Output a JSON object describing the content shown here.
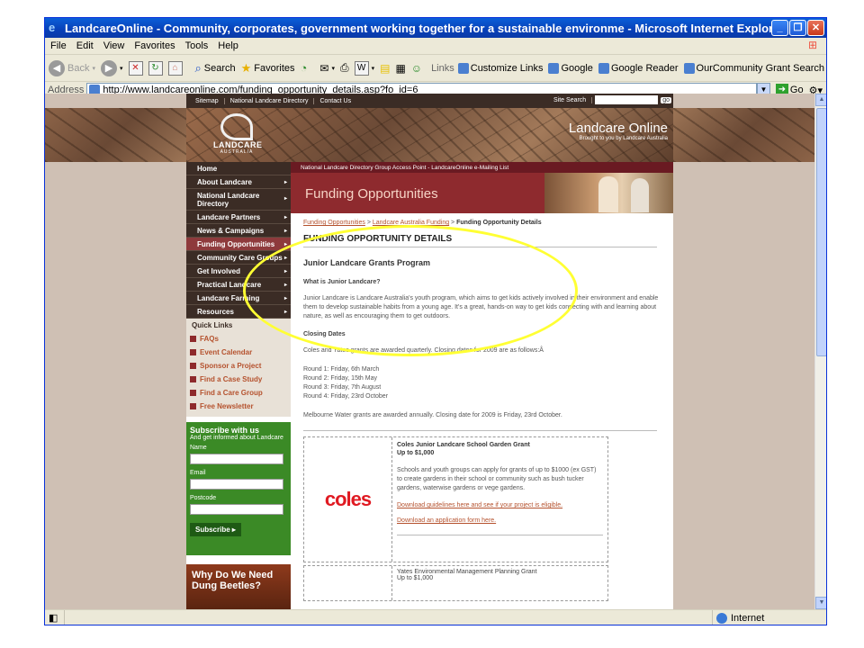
{
  "window": {
    "title": "LandcareOnline - Community, corporates, government working together for a sustainable environme - Microsoft Internet Explorer",
    "controls": [
      "_",
      "❐",
      "✕"
    ]
  },
  "menu": [
    "File",
    "Edit",
    "View",
    "Favorites",
    "Tools",
    "Help"
  ],
  "toolbar": {
    "back": "Back",
    "search": "Search",
    "favorites": "Favorites",
    "links_label": "Links",
    "links": [
      "Customize Links",
      "Google",
      "Google Reader",
      "OurCommunity Grant Search"
    ]
  },
  "address": {
    "label": "Address",
    "url": "http://www.landcareonline.com/funding_opportunity_details.asp?fo_id=6",
    "go": "Go"
  },
  "status": {
    "zone": "Internet"
  },
  "site": {
    "topnav": [
      "Sitemap",
      "National Landcare Directory",
      "Contact Us"
    ],
    "search_label": "Site Search",
    "search_go": "go",
    "logo_word": "LANDCARE",
    "logo_sub": "AUSTRALIA",
    "brand": "Landcare Online",
    "brand_tag": "Brought to you by Landcare Australia",
    "ribbon": "National Landcare Directory Group Access Point - LandcareOnline e-Mailing List",
    "hero_title": "Funding Opportunities",
    "nav": [
      {
        "label": "Home",
        "arrow": ""
      },
      {
        "label": "About Landcare",
        "arrow": "▸"
      },
      {
        "label": "National Landcare Directory",
        "arrow": "▸"
      },
      {
        "label": "Landcare Partners",
        "arrow": "▸"
      },
      {
        "label": "News & Campaigns",
        "arrow": "▸"
      },
      {
        "label": "Funding Opportunities",
        "arrow": "▸"
      },
      {
        "label": "Community Care Groups",
        "arrow": "▸"
      },
      {
        "label": "Get Involved",
        "arrow": "▸"
      },
      {
        "label": "Practical Landcare",
        "arrow": "▸"
      },
      {
        "label": "Landcare Farming",
        "arrow": "▸"
      },
      {
        "label": "Resources",
        "arrow": "▸"
      }
    ],
    "quick_title": "Quick Links",
    "quick": [
      "FAQs",
      "Event Calendar",
      "Sponsor a Project",
      "Find a Case Study",
      "Find a Care Group",
      "Free Newsletter"
    ],
    "subscribe": {
      "heading": "Subscribe with us",
      "desc": "And get informed about Landcare",
      "name": "Name",
      "email": "Email",
      "postcode": "Postcode",
      "button": "Subscribe ▸"
    },
    "promo": "Why Do We Need Dung Beetles?",
    "breadcrumb": {
      "c1": "Funding Opportunities",
      "sep1": " > ",
      "c2": "Landcare Australia Funding",
      "sep2": " > ",
      "current": "Funding Opportunity Details"
    },
    "heading": "FUNDING OPPORTUNITY DETAILS",
    "program": "Junior Landcare Grants Program",
    "what_heading": "What is Junior Landcare?",
    "what_text": "Junior Landcare is Landcare Australia's youth program, which aims to get kids actively involved in their environment and enable them to develop sustainable habits from a young age. It's a great, hands-on way to get kids connecting with and learning about nature, as well as encouraging them to get outdoors.",
    "closing_heading": "Closing Dates",
    "closing_text": "Coles and Yates grants are awarded quarterly. Closing dates for 2009 are as follows:Â",
    "rounds": [
      "Round 1: Friday, 6th March",
      "Round 2: Friday, 15th May",
      "Round 3: Friday, 7th August",
      "Round 4: Friday, 23rd October"
    ],
    "melbourne_text": "Melbourne Water grants are awarded annually. Closing date for 2009 is Friday, 23rd October.",
    "grant1": {
      "logo": "coles",
      "title": "Coles Junior Landcare School Garden Grant",
      "amount": "Up to $1,000",
      "desc": "Schools and youth groups can apply for grants of up to $1000 (ex GST) to create gardens in their school or community such as bush tucker gardens, waterwise gardens or vege gardens.",
      "link1": "Download guidelines here and see if your project is eligible.",
      "link2": "Download an application form here."
    },
    "grant2": {
      "title": "Yates Environmental Management Planning Grant",
      "amount": "Up to $1,000"
    }
  },
  "colors": {
    "highlight": "#ffff33",
    "nav_bg": "#3b2c25",
    "accent": "#8e2a2e"
  }
}
